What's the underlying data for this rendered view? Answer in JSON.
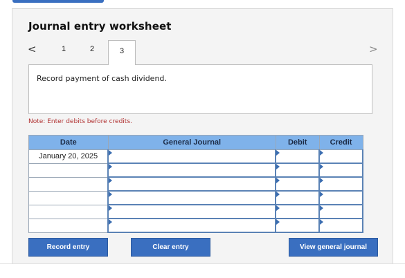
{
  "worksheet": {
    "title": "Journal entry worksheet",
    "tabs": [
      "1",
      "2",
      "3"
    ],
    "active_tab": "3",
    "prev_glyph": "<",
    "next_glyph": ">"
  },
  "instruction": "Record payment of cash dividend.",
  "note": "Note: Enter debits before credits.",
  "table": {
    "headers": {
      "date": "Date",
      "general_journal": "General Journal",
      "debit": "Debit",
      "credit": "Credit"
    },
    "rows": [
      {
        "date": "January 20, 2025",
        "account": "",
        "debit": "",
        "credit": ""
      },
      {
        "date": "",
        "account": "",
        "debit": "",
        "credit": ""
      },
      {
        "date": "",
        "account": "",
        "debit": "",
        "credit": ""
      },
      {
        "date": "",
        "account": "",
        "debit": "",
        "credit": ""
      },
      {
        "date": "",
        "account": "",
        "debit": "",
        "credit": ""
      },
      {
        "date": "",
        "account": "",
        "debit": "",
        "credit": ""
      }
    ]
  },
  "buttons": {
    "record": "Record entry",
    "clear": "Clear entry",
    "view": "View general journal"
  },
  "colors": {
    "header_bg": "#7fb2ea",
    "button_bg": "#3a6fc0",
    "note_text": "#b03030"
  }
}
